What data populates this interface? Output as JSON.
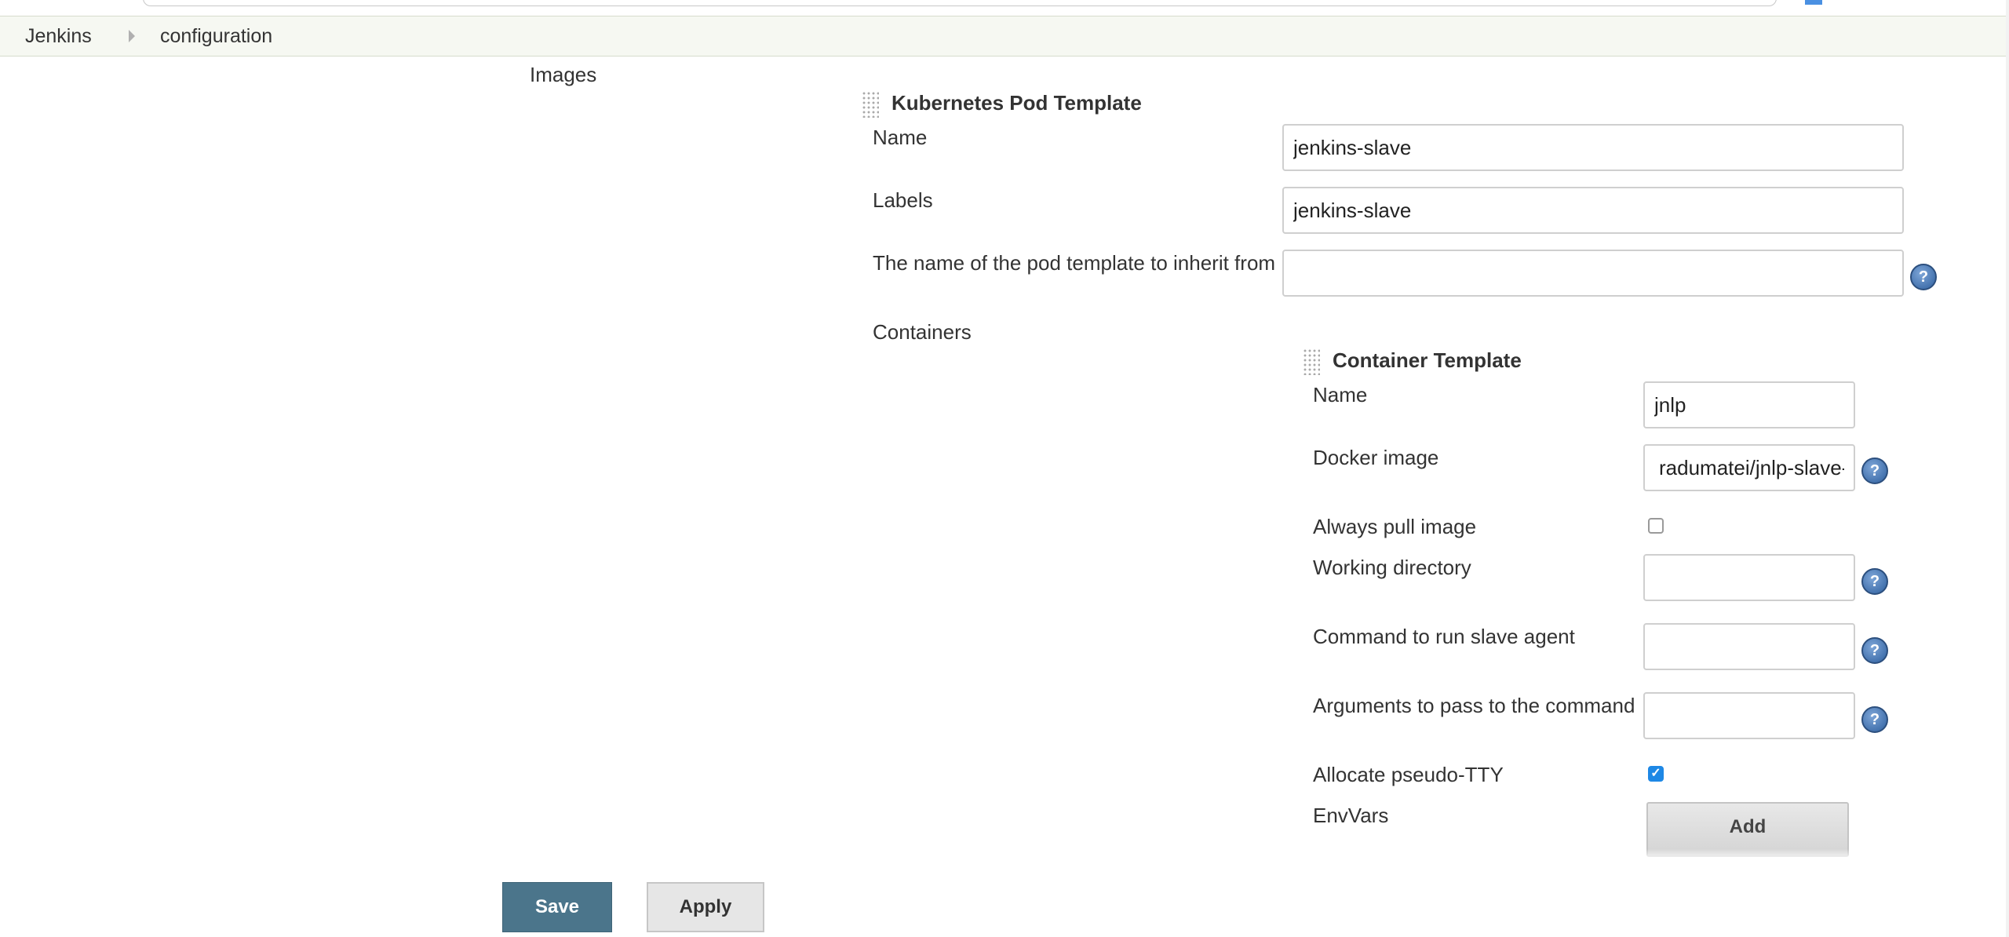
{
  "breadcrumb": {
    "items": [
      "Jenkins",
      "configuration"
    ]
  },
  "section": {
    "label": "Images"
  },
  "pod_template": {
    "title": "Kubernetes Pod Template",
    "name_label": "Name",
    "name_value": "jenkins-slave",
    "labels_label": "Labels",
    "labels_value": "jenkins-slave",
    "inherit_label": "The name of the pod template to inherit from",
    "inherit_value": "",
    "containers_label": "Containers"
  },
  "container_template": {
    "title": "Container Template",
    "name_label": "Name",
    "name_value": "jnlp",
    "docker_image_label": "Docker image",
    "docker_image_value": "radumatei/jnlp-slave-",
    "always_pull_label": "Always pull image",
    "always_pull_checked": false,
    "working_dir_label": "Working directory",
    "working_dir_value": "",
    "command_label": "Command to run slave agent",
    "command_value": "",
    "args_label": "Arguments to pass to the command",
    "args_value": "",
    "tty_label": "Allocate pseudo-TTY",
    "tty_checked": true,
    "envvars_label": "EnvVars",
    "add_label": "Add"
  },
  "buttons": {
    "save": "Save",
    "apply": "Apply"
  },
  "icons": {
    "help": "help-icon",
    "grip": "drag-handle-icon"
  },
  "colors": {
    "save_button": "#4b758b",
    "breadcrumb_bg": "#f6f8f2",
    "checkbox_checked": "#1e88e5",
    "help_icon": "#2e5f9e"
  }
}
